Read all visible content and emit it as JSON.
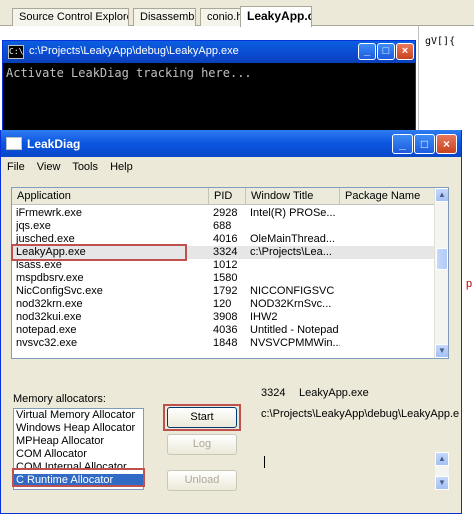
{
  "ide": {
    "tabs": [
      "Source Control Explorer",
      "Disassembly",
      "conio.h",
      "LeakyApp.cpp"
    ],
    "code_fragment": "gV[]{"
  },
  "console": {
    "title": "c:\\Projects\\LeakyApp\\debug\\LeakyApp.exe",
    "icon_text": "C:\\",
    "output": "Activate LeakDiag tracking here..."
  },
  "leakdiag": {
    "title": "LeakDiag",
    "menu": [
      "File",
      "View",
      "Tools",
      "Help"
    ],
    "columns": [
      "Application",
      "PID",
      "Window Title",
      "Package Name"
    ],
    "rows": [
      {
        "app": "iFrmewrk.exe",
        "pid": "2928",
        "title": "Intel(R) PROSe..."
      },
      {
        "app": "jqs.exe",
        "pid": "688",
        "title": ""
      },
      {
        "app": "jusched.exe",
        "pid": "4016",
        "title": "OleMainThread..."
      },
      {
        "app": "LeakyApp.exe",
        "pid": "3324",
        "title": "c:\\Projects\\Lea..."
      },
      {
        "app": "lsass.exe",
        "pid": "1012",
        "title": ""
      },
      {
        "app": "mspdbsrv.exe",
        "pid": "1580",
        "title": ""
      },
      {
        "app": "NicConfigSvc.exe",
        "pid": "1792",
        "title": "NICCONFIGSVC"
      },
      {
        "app": "nod32krn.exe",
        "pid": "120",
        "title": "NOD32KrnSvc..."
      },
      {
        "app": "nod32kui.exe",
        "pid": "3908",
        "title": "IHW2"
      },
      {
        "app": "notepad.exe",
        "pid": "4036",
        "title": "Untitled - Notepad"
      },
      {
        "app": "nvsvc32.exe",
        "pid": "1848",
        "title": "NVSVCPMMWin..."
      }
    ],
    "memory_label": "Memory allocators:",
    "allocators": [
      "Virtual Memory Allocator",
      "Windows Heap Allocator",
      "MPHeap Allocator",
      "COM Allocator",
      "COM Internal Allocator",
      "C Runtime Allocator"
    ],
    "buttons": {
      "start": "Start",
      "log": "Log",
      "unload": "Unload"
    },
    "selected_pid": "3324",
    "selected_app": "LeakyApp.exe",
    "selected_path": "c:\\Projects\\LeakyApp\\debug\\LeakyApp.e"
  }
}
